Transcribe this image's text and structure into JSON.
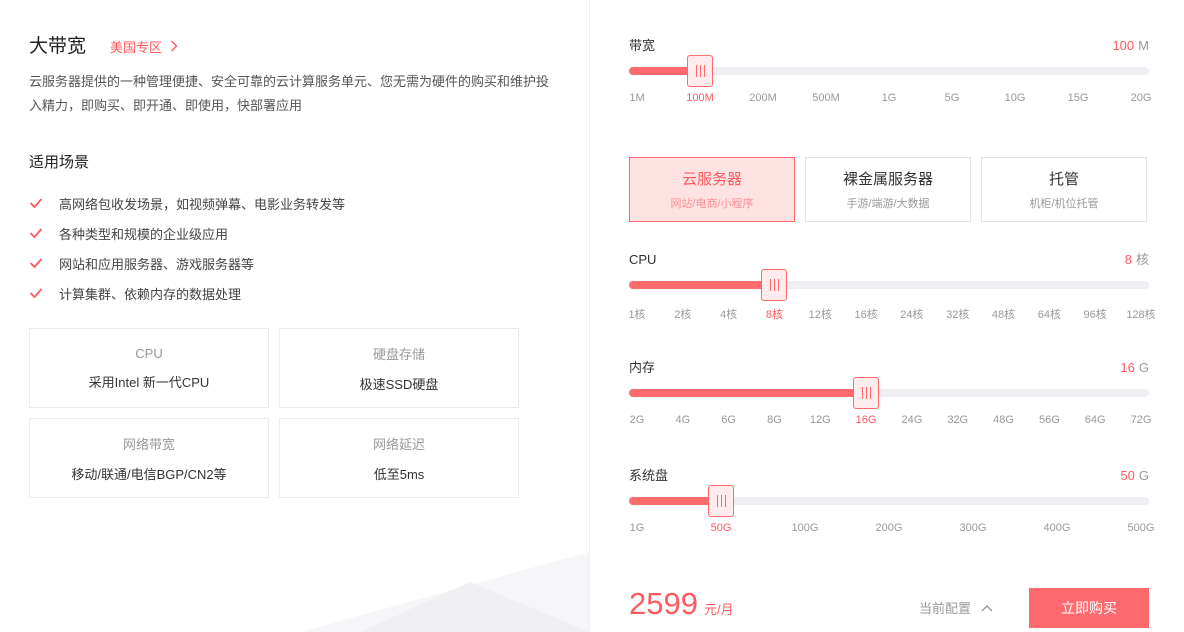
{
  "header": {
    "title": "大带宽",
    "region_link": "美国专区"
  },
  "description": "云服务器提供的一种管理便捷、安全可靠的云计算服务单元、您无需为硬件的购买和维护投入精力，即购买、即开通、即使用，快部署应用",
  "scenarios": {
    "title": "适用场景",
    "items": [
      "高网络包收发场景，如视频弹幕、电影业务转发等",
      "各种类型和规模的企业级应用",
      "网站和应用服务器、游戏服务器等",
      "计算集群、依赖内存的数据处理"
    ]
  },
  "specs": [
    {
      "key": "CPU",
      "value": "采用Intel 新一代CPU"
    },
    {
      "key": "硬盘存储",
      "value": "极速SSD硬盘"
    },
    {
      "key": "网络带宽",
      "value": "移动/联通/电信BGP/CN2等"
    },
    {
      "key": "网络延迟",
      "value": "低至5ms"
    }
  ],
  "bandwidth": {
    "label": "带宽",
    "value": "100",
    "unit": "M",
    "ticks": [
      "1M",
      "100M",
      "200M",
      "500M",
      "1G",
      "5G",
      "10G",
      "15G",
      "20G"
    ],
    "selected_index": 1
  },
  "server_types": [
    {
      "name": "云服务器",
      "sub": "网站/电商/小程序",
      "selected": true
    },
    {
      "name": "裸金属服务器",
      "sub": "手游/端游/大数据",
      "selected": false
    },
    {
      "name": "托管",
      "sub": "机柜/机位托管",
      "selected": false
    }
  ],
  "cpu": {
    "label": "CPU",
    "value": "8",
    "unit": "核",
    "ticks": [
      "1核",
      "2核",
      "4核",
      "8核",
      "12核",
      "16核",
      "24核",
      "32核",
      "48核",
      "64核",
      "96核",
      "128核"
    ],
    "selected_index": 3
  },
  "memory": {
    "label": "内存",
    "value": "16",
    "unit": "G",
    "ticks": [
      "2G",
      "4G",
      "6G",
      "8G",
      "12G",
      "16G",
      "24G",
      "32G",
      "48G",
      "56G",
      "64G",
      "72G"
    ],
    "selected_index": 5
  },
  "disk": {
    "label": "系统盘",
    "value": "50",
    "unit": "G",
    "ticks": [
      "1G",
      "50G",
      "100G",
      "200G",
      "300G",
      "400G",
      "500G"
    ],
    "selected_index": 1
  },
  "footer": {
    "price": "2599",
    "price_unit": "元/月",
    "current_config": "当前配置",
    "buy_label": "立即购买"
  },
  "colors": {
    "accent": "#ff5a5f",
    "accent_light": "#ffe3e3",
    "track": "#efeff3"
  }
}
